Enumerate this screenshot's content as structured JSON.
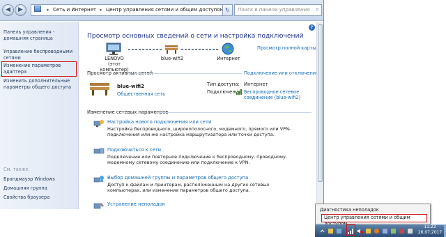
{
  "address_bar": {
    "crumbs": [
      "Сеть и Интернет",
      "Центр управления сетями и общим доступом"
    ],
    "search_placeholder": "Поиск в панели управления"
  },
  "sidebar": {
    "items": [
      {
        "label": "Панель управления - домашняя страница"
      },
      {
        "label": "Управление беспроводными сетями"
      },
      {
        "label": "Изменение параметров адаптера"
      },
      {
        "label": "Изменить дополнительные параметры общего доступа"
      }
    ],
    "see_also_header": "См. также",
    "see_also": [
      {
        "label": "Брандмауэр Windows"
      },
      {
        "label": "Домашняя группа"
      },
      {
        "label": "Свойства браузера"
      }
    ]
  },
  "main": {
    "title": "Просмотр основных сведений о сети и настройка подключений",
    "view_full_map": "Просмотр полной карты",
    "nodes": [
      {
        "name": "LENOVO",
        "sub": "(этот компьютер)"
      },
      {
        "name": "blue-wifi2",
        "sub": ""
      },
      {
        "name": "Интернет",
        "sub": ""
      }
    ],
    "active_networks_label": "Просмотр активных сетей",
    "connect_disconnect": "Подключение или отключение",
    "network": {
      "name": "blue-wifi2",
      "type": "Общественная сеть",
      "access_type_label": "Тип доступа:",
      "access_type_value": "Интернет",
      "connections_label": "Подключения:",
      "connections_value": "Беспроводное сетевое соединение (blue-wifi2)"
    },
    "change_settings_label": "Изменение сетевых параметров",
    "tasks": [
      {
        "title": "Настройка нового подключения или сети",
        "desc": "Настройка беспроводного, широкополосного, модемного, прямого или VPN-подключения или же настройка маршрутизатора или точки доступа."
      },
      {
        "title": "Подключиться к сети",
        "desc": "Подключение или повторное подключение к беспроводному, проводному, модемному сетевому соединению или подключение к VPN."
      },
      {
        "title": "Выбор домашней группы и параметров общего доступа",
        "desc": "Доступ к файлам и принтерам, расположенным на других сетевых компьютерах, или изменение параметров общего доступа."
      },
      {
        "title": "Устранение неполадок",
        "desc": ""
      }
    ]
  },
  "popup": {
    "item1": "Диагностика неполадок",
    "item2": "Центр управления сетями и общим доступом"
  },
  "taskbar": {
    "time": "11:22",
    "date": "26.07.2017"
  },
  "colors": {
    "link": "#0f6ab7",
    "title": "#1e3287",
    "highlight": "#d0121b"
  }
}
